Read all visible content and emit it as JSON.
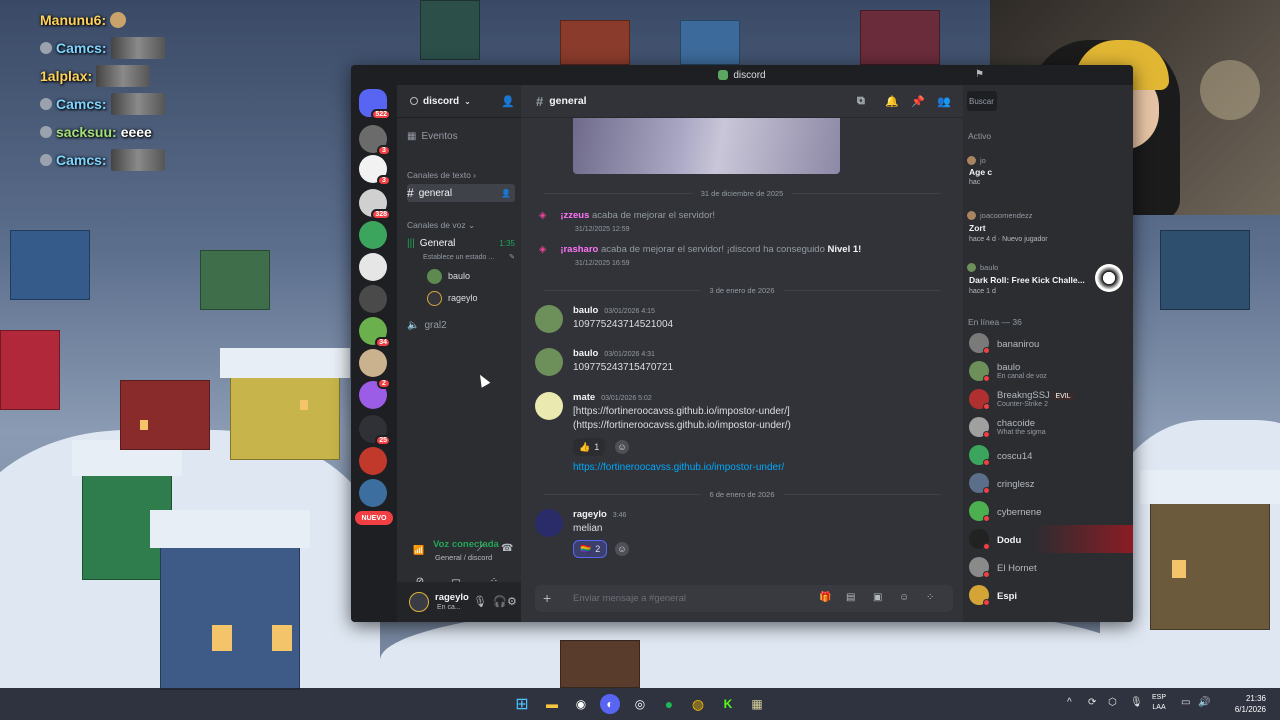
{
  "stream_chat": [
    {
      "user": "Manunu6:",
      "color": "orange",
      "text": ""
    },
    {
      "user": "Camcs:",
      "color": "blue",
      "text": ""
    },
    {
      "user": "1alplax:",
      "color": "orange",
      "text": ""
    },
    {
      "user": "Camcs:",
      "color": "blue",
      "text": ""
    },
    {
      "user": "sacksuu:",
      "color": "green",
      "text": "eeee"
    },
    {
      "user": "Camcs:",
      "color": "blue",
      "text": ""
    }
  ],
  "window": {
    "title": "discord"
  },
  "servers": {
    "badges": [
      "522",
      "3",
      "3",
      "328",
      "34",
      "2",
      "25"
    ],
    "new_label": "NUEVO"
  },
  "sidebar": {
    "guild_name": "discord",
    "events_label": "Eventos",
    "text_category": "Canales de texto",
    "text_channel": "general",
    "voice_category": "Canales de voz",
    "voice_channel": "General",
    "voice_timer": "1:35",
    "voice_status_placeholder": "Establece un estado ...",
    "voice_users": [
      "baulo",
      "rageylo"
    ],
    "voice_channel_2": "gral2"
  },
  "voice_panel": {
    "status": "Voz conectada",
    "location": "General / discord"
  },
  "user_panel": {
    "name": "rageylo",
    "status": "En ca..."
  },
  "main": {
    "channel_name": "general",
    "date_1": "31 de diciembre de 2025",
    "sys_1": {
      "who": "¡zzeus",
      "text": " acaba de mejorar el servidor!",
      "time": "31/12/2025 12:59"
    },
    "sys_2": {
      "who": "¡rasharo",
      "text": " acaba de mejorar el servidor! ¡discord ha conseguido ",
      "level": "Nivel 1!",
      "time": "31/12/2025 16:59"
    },
    "date_2": "3 de enero de 2026",
    "messages": [
      {
        "author": "baulo",
        "time": "03/01/2026 4:15",
        "text": "109775243714521004"
      },
      {
        "author": "baulo",
        "time": "03/01/2026 4:31",
        "text": "109775243715470721"
      },
      {
        "author": "mate",
        "time": "03/01/2026 5:02",
        "text": "[https://fortineroocavss.github.io/impostor-under/]",
        "text2": "(https://fortineroocavss.github.io/impostor-under/)",
        "reaction": "👍",
        "reaction_count": "1",
        "link": "https://fortineroocavss.github.io/impostor-under/"
      },
      {
        "author": "rageylo",
        "time": "3:46",
        "text": "melian",
        "reaction": "🏳️‍🌈",
        "reaction_count": "2"
      }
    ],
    "date_3": "6 de enero de 2026",
    "composer_placeholder": "Enviar mensaje a #general"
  },
  "members": {
    "search_placeholder": "Buscar",
    "activity_label": "Activo",
    "activities": [
      {
        "user": "jo",
        "game": "Age c",
        "meta": "hac"
      },
      {
        "user": "joacoomendezz",
        "game": "Zort",
        "meta": "hace 4 d",
        "meta2": "Nuevo jugador"
      },
      {
        "user": "baulo",
        "game": "Dark Roll: Free Kick Challe...",
        "meta": "hace 1 d"
      }
    ],
    "online_label": "En línea — 36",
    "list": [
      {
        "name": "bananirou",
        "sub": ""
      },
      {
        "name": "baulo",
        "sub": "En canal de voz"
      },
      {
        "name": "BreakngSSJ",
        "sub": "Counter-Strike 2",
        "tag": "EVIL"
      },
      {
        "name": "chacoide",
        "sub": "What the sigma"
      },
      {
        "name": "coscu14",
        "sub": ""
      },
      {
        "name": "cringlesz",
        "sub": ""
      },
      {
        "name": "cybernene",
        "sub": ""
      },
      {
        "name": "Dodu",
        "sub": ""
      },
      {
        "name": "El Hornet",
        "sub": ""
      },
      {
        "name": "Espi",
        "sub": ""
      }
    ]
  },
  "taskbar": {
    "lang": "ESP",
    "lang2": "LAA",
    "time": "21:36",
    "date": "6/1/2026"
  }
}
